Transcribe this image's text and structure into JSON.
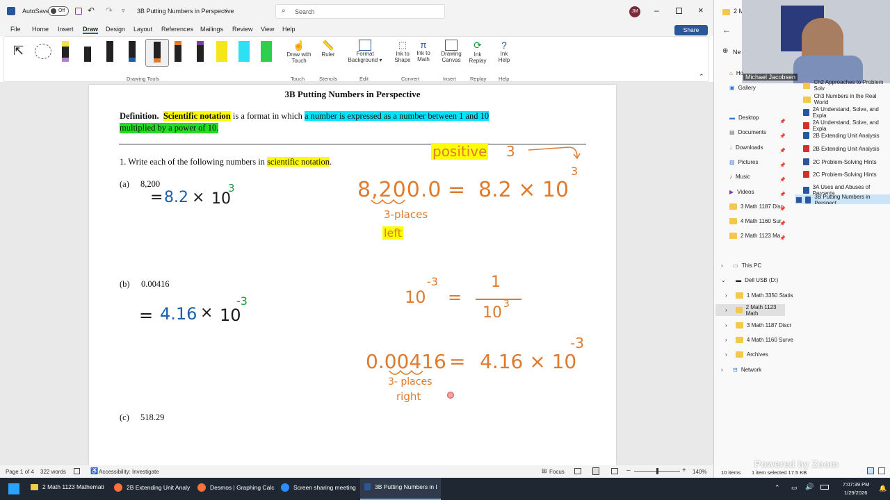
{
  "titlebar": {
    "autosave_label": "AutoSave",
    "autosave_state": "Off",
    "doc_title": "3B Putting Numbers in Perspective",
    "search_placeholder": "Search",
    "user_initials": "JM"
  },
  "menu": [
    "File",
    "Home",
    "Insert",
    "Draw",
    "Design",
    "Layout",
    "References",
    "Mailings",
    "Review",
    "View",
    "Help"
  ],
  "share_label": "Share",
  "ribbon": {
    "group_drawing_tools": "Drawing Tools",
    "draw_touch": [
      "Draw with",
      "Touch"
    ],
    "ruler": "Ruler",
    "format_bg": [
      "Format",
      "Background ▾"
    ],
    "ink_shape": [
      "Ink to",
      "Shape"
    ],
    "ink_math": [
      "Ink to",
      "Math"
    ],
    "drawing_canvas": [
      "Drawing",
      "Canvas"
    ],
    "ink_replay": [
      "Ink",
      "Replay"
    ],
    "ink_help": [
      "Ink",
      "Help"
    ],
    "groups": [
      "Touch",
      "Stencils",
      "Edit",
      "Convert",
      "Insert",
      "Replay",
      "Help"
    ]
  },
  "doc": {
    "heading": "3B Putting Numbers in Perspective",
    "def_label": "Definition.",
    "def_term": "Scientific notation",
    "def_mid": " is a format in which ",
    "def_hl1": "a number is expressed as a number between 1 and 10",
    "def_hl2": "multiplied by a power of 10.",
    "q1_prefix": "1.  Write each of the following numbers in ",
    "q1_hl": "scientific notation",
    "q1_suffix": ".",
    "a_label": "(a)",
    "a_value": "8,200",
    "b_label": "(b)",
    "b_value": "0.00416",
    "c_label": "(c)",
    "c_value": "518.29"
  },
  "ink": {
    "a_eq": "=",
    "a_coef": "8.2",
    "a_times": "×",
    "a_base": "10",
    "a_exp": "3",
    "positive": "positive",
    "three": "3",
    "arrow_exp": "3",
    "big_a_left": "8,200.0",
    "big_a_eq": "=",
    "big_a_right": "8.2 × 10",
    "places_a": "3-places",
    "left": "left",
    "b_eq": "=",
    "b_coef": "4.16",
    "b_times": "×",
    "b_base": "10",
    "b_exp": "-3",
    "frac_left": "10",
    "frac_left_exp": "-3",
    "frac_eq": "=",
    "frac_num": "1",
    "frac_den": "10",
    "frac_den_exp": "3",
    "big_b_left": "0.00416",
    "big_b_eq": "=",
    "big_b_right": "4.16 × 10",
    "big_b_exp": "-3",
    "places_b": "3- places",
    "right": "right"
  },
  "status": {
    "page": "Page 1 of 4",
    "words": "322 words",
    "accessibility": "Accessibility: Investigate",
    "focus": "Focus",
    "zoom": "140%"
  },
  "explorer": {
    "tab_label": "2 M",
    "webcam_name": "Michael Jacobsen",
    "nav_top": [
      "Ho",
      "Gallery"
    ],
    "quick": [
      "Desktop",
      "Documents",
      "Downloads",
      "Pictures",
      "Music",
      "Videos",
      "3 Math 1187 Disc",
      "4 Math 1160 Sur",
      "2 Math 1123 Ma"
    ],
    "files": [
      "Ch2 Approaches to Problem Solv",
      "Ch3 Numbers in the Real World",
      "2A Understand, Solve, and Expla",
      "2A Understand, Solve, and Expla",
      "2B Extending Unit Analysis",
      "2B Extending Unit Analysis",
      "2C Problem-Solving Hints",
      "2C Problem-Solving Hints",
      "3A Uses and Abuses of Percenta",
      "3B Putting Numbers in Perspect"
    ],
    "this_pc": "This PC",
    "usb": "Dell USB (D:)",
    "usb_items": [
      "1 Math 3350 Statis",
      "2 Math 1123 Math",
      "3 Math 1187 Discr",
      "4 Math 1160 Surve",
      "Archives"
    ],
    "network": "Network",
    "status_items": "10 items",
    "status_sel": "1 item selected  17.5 KB",
    "watermark": "Powered by Zoom"
  },
  "taskbar": {
    "items": [
      "2 Math 1123 Mathemati",
      "2B Extending Unit Analy",
      "Desmos | Graphing Calc",
      "Screen sharing meeting",
      "3B Putting Numbers in I"
    ],
    "time": "7:07:39 PM",
    "date": "1/29/2026"
  },
  "colors": {
    "ink_blue": "#1f5fa8",
    "ink_black": "#1a1a1a",
    "ink_orange": "#e07a2c",
    "ink_green": "#1a9a3a",
    "word_blue": "#2b579a"
  }
}
